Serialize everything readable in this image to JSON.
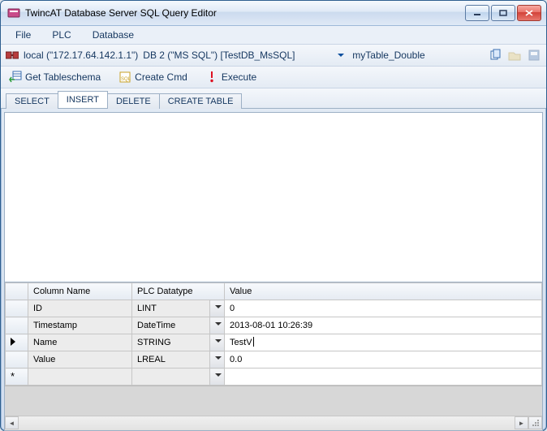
{
  "window": {
    "title": "TwincAT Database Server SQL Query Editor"
  },
  "menu": {
    "file": "File",
    "plc": "PLC",
    "database": "Database"
  },
  "toolbar1": {
    "connection": "local (\"172.17.64.142.1.1\")",
    "database_select": "DB 2 (\"MS SQL\") [TestDB_MsSQL]",
    "table_name": "myTable_Double"
  },
  "toolbar2": {
    "get_tableschema": "Get Tableschema",
    "create_cmd": "Create Cmd",
    "execute": "Execute"
  },
  "tabs": {
    "select": "SELECT",
    "insert": "INSERT",
    "delete": "DELETE",
    "create_table": "CREATE TABLE"
  },
  "grid": {
    "headers": {
      "column_name": "Column Name",
      "plc_datatype": "PLC Datatype",
      "value": "Value"
    },
    "rows": [
      {
        "name": "ID",
        "type": "LINT",
        "value": "0"
      },
      {
        "name": "Timestamp",
        "type": "DateTime",
        "value": "2013-08-01 10:26:39"
      },
      {
        "name": "Name",
        "type": "STRING",
        "value": "TestV"
      },
      {
        "name": "Value",
        "type": "LREAL",
        "value": "0.0"
      }
    ]
  }
}
